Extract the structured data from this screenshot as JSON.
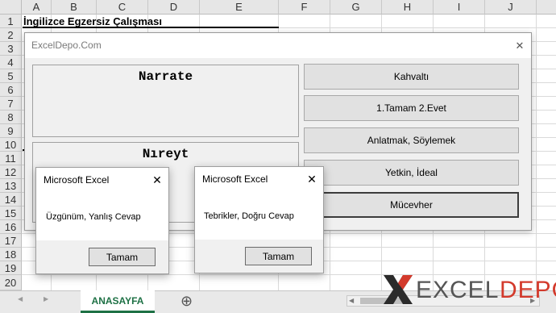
{
  "columns": [
    "A",
    "B",
    "C",
    "D",
    "E",
    "F",
    "G",
    "H",
    "I",
    "J"
  ],
  "rows": [
    "1",
    "2",
    "3",
    "4",
    "5",
    "6",
    "7",
    "8",
    "9",
    "10",
    "11",
    "12",
    "13",
    "14",
    "15",
    "16",
    "17",
    "18",
    "19",
    "20"
  ],
  "sheet": {
    "a1_text": "İngilizce Egzersiz Çalışması",
    "tab_label": "ANASAYFA",
    "add_sheet_symbol": "⊕"
  },
  "userform": {
    "title": "ExcelDepo.Com",
    "close_symbol": "✕",
    "english_word": "Narrate",
    "pronunciation": "Nıreyt",
    "options": [
      "Kahvaltı",
      "1.Tamam 2.Evet",
      "Anlatmak, Söylemek",
      "Yetkin, İdeal",
      "Mücevher"
    ]
  },
  "msgbox_wrong": {
    "title": "Microsoft Excel",
    "message": "Üzgünüm, Yanlış Cevap",
    "ok_label": "Tamam",
    "close_symbol": "✕"
  },
  "msgbox_right": {
    "title": "Microsoft Excel",
    "message": "Tebrikler, Doğru Cevap",
    "ok_label": "Tamam",
    "close_symbol": "✕"
  },
  "logo": {
    "text_excel": "EXCEL",
    "text_depo": "DEPO",
    "colors": {
      "excel": "#555555",
      "depo": "#d33a2c"
    }
  },
  "nav": {
    "left_arrow": "◀",
    "right_arrow": "▶"
  }
}
